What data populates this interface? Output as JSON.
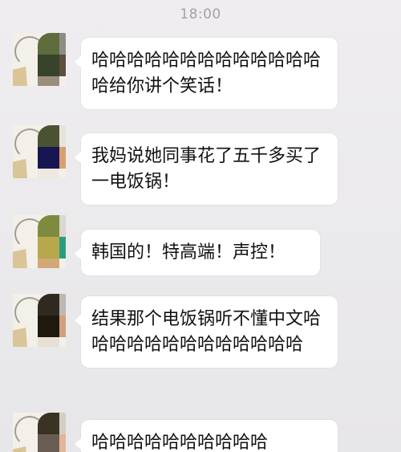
{
  "status": {
    "time": "18:00"
  },
  "messages": [
    {
      "text": "哈哈哈哈哈哈哈哈哈哈哈哈哈哈给你讲个笑话！"
    },
    {
      "text": "我妈说她同事花了五千多买了一电饭锅！"
    },
    {
      "text": "韩国的！特高端！声控！"
    },
    {
      "text": "结果那个电饭锅听不懂中文哈哈哈哈哈哈哈哈哈哈哈哈哈"
    },
    {
      "text": "哈哈哈哈哈哈哈哈哈哈"
    }
  ],
  "avatar_colors": [
    [
      "#5f6c3c",
      "#8c8e86",
      "#38432c",
      "#5f4e3c",
      "#9a8f7f"
    ],
    [
      "#4b5231",
      "#e7e2dc",
      "#171652",
      "#d7a16e",
      "#efe8e0"
    ],
    [
      "#7e8a3d",
      "#dbd6cf",
      "#b8a84c",
      "#299e7e",
      "#d3a879"
    ],
    [
      "#2f291f",
      "#bdb8b0",
      "#1f180f",
      "#d2a07a",
      "#e9e0d5"
    ],
    [
      "#3a3324",
      "#d3cdc2",
      "#695d53",
      "#e0b79a",
      "#f0e7dc"
    ]
  ]
}
